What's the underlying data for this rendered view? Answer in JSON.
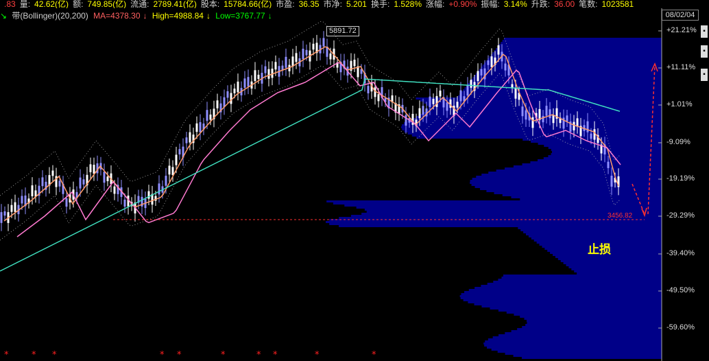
{
  "topbar": {
    "items": [
      {
        "label": "",
        "value": ".83",
        "color": "r"
      },
      {
        "label": "量:",
        "value": "42.62(亿)",
        "color": "y"
      },
      {
        "label": "额:",
        "value": "749.85(亿)",
        "color": "y"
      },
      {
        "label": "流通:",
        "value": "2789.41(亿)",
        "color": "y"
      },
      {
        "label": "股本:",
        "value": "15784.66(亿)",
        "color": "y"
      },
      {
        "label": "市盈:",
        "value": "36.35",
        "color": "y"
      },
      {
        "label": "市净:",
        "value": "5.201",
        "color": "y"
      },
      {
        "label": "换手:",
        "value": "1.528%",
        "color": "y"
      },
      {
        "label": "涨幅:",
        "value": "+0.90%",
        "color": "r"
      },
      {
        "label": "振幅:",
        "value": "3.14%",
        "color": "y"
      },
      {
        "label": "升跌:",
        "value": "36.00",
        "color": "r"
      },
      {
        "label": "笔数:",
        "value": "1023581",
        "color": "y"
      }
    ]
  },
  "indicator_bar": {
    "name": "带(Bollinger)(20,200)",
    "ma": "MA=4378.30",
    "high": "High=4988.84",
    "low": "Low=3767.77"
  },
  "date_label": "08/02/04",
  "peak_label": "5891.72",
  "stop_loss_price": "3456.82",
  "stop_loss_text": "止损",
  "y_axis_ticks": [
    "+21.21%",
    "+11.11%",
    "+1.01%",
    "-9.09%",
    "-19.19%",
    "-29.29%",
    "-39.40%",
    "-49.50%",
    "-59.60%"
  ],
  "colors": {
    "bg": "#000000",
    "up_candle": "#ffffff",
    "down_candle": "#8f8fff",
    "ma_short": "#ff9a6a",
    "ma_mid": "#ff7ad0",
    "ma_long": "#40e0c0",
    "volume_profile": "#0000a0",
    "stop_line": "#ff3030",
    "marker": "#ff2020"
  },
  "chart_data": {
    "type": "candlestick",
    "title": "",
    "last_price_change_pct": 0.9,
    "peak": 5891.72,
    "stop_loss": 3456.82,
    "y_axis_pct_ticks": [
      21.21,
      11.11,
      1.01,
      -9.09,
      -19.19,
      -29.29,
      -39.4,
      -49.5,
      -59.6
    ],
    "bollinger": {
      "period": 20,
      "width": 200,
      "ma": 4378.3,
      "high": 4988.84,
      "low": 3767.77
    }
  }
}
